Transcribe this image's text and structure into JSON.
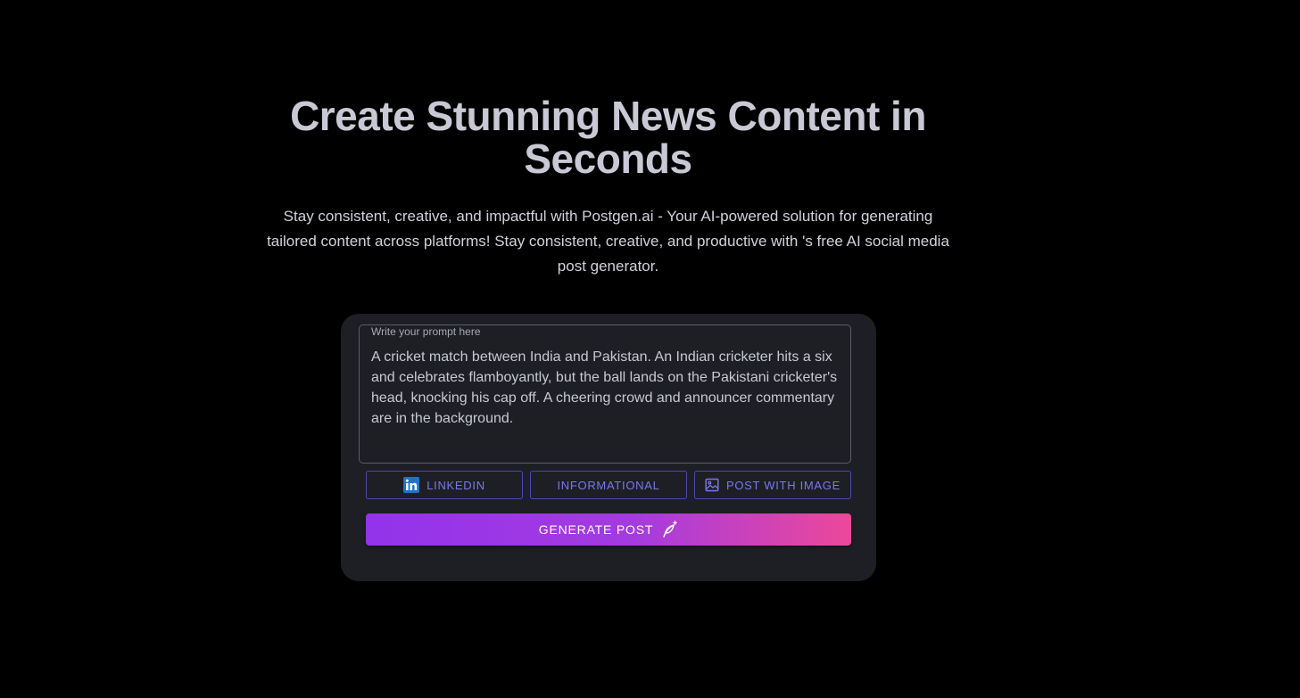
{
  "hero": {
    "title_line1": "Create Stunning News Content in",
    "title_line2": "Seconds",
    "subtitle": "Stay consistent, creative, and impactful with Postgen.ai - Your AI-powered solution for generating tailored content across platforms! Stay consistent, creative, and productive with 's free AI social media post generator."
  },
  "prompt": {
    "label": "Write your prompt here",
    "value": "A cricket match between India and Pakistan. An Indian cricketer hits a six and celebrates flamboyantly, but the ball lands on the Pakistani cricketer's head, knocking his cap off. A cheering crowd and announcer commentary are in the background."
  },
  "options": {
    "platform": {
      "label": "LINKEDIN",
      "icon": "linkedin-icon"
    },
    "tone": {
      "label": "INFORMATIONAL"
    },
    "format": {
      "label": "POST WITH IMAGE",
      "icon": "image-icon"
    }
  },
  "generate": {
    "label": "GENERATE POST",
    "icon": "feather-sparkle-icon"
  },
  "colors": {
    "background": "#000000",
    "card": "#1e1f25",
    "accent": "#7a78ee",
    "gradient_start": "#9333ea",
    "gradient_end": "#ec4899"
  }
}
